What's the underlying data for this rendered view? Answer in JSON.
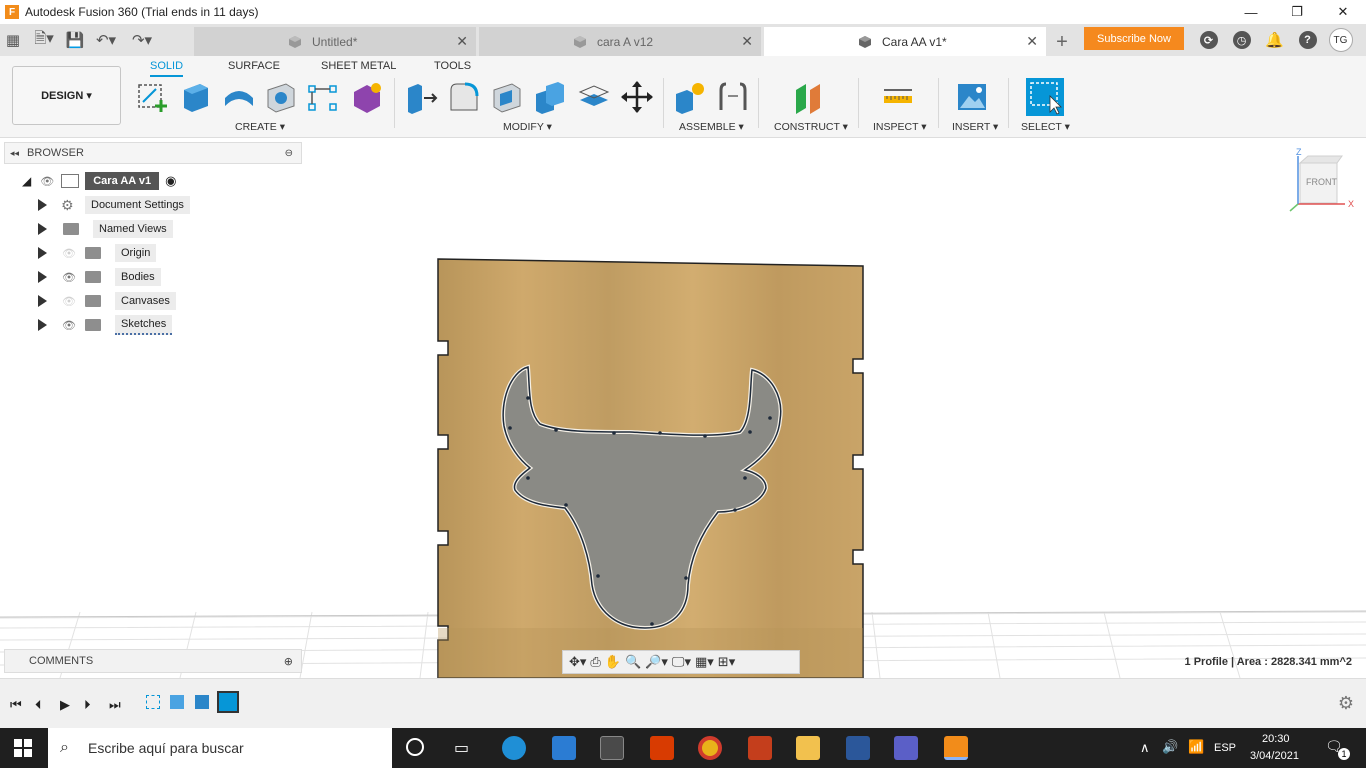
{
  "window": {
    "title": "Autodesk Fusion 360 (Trial ends in 11 days)",
    "logo": "F"
  },
  "tabs": [
    {
      "label": "Untitled*",
      "active": false
    },
    {
      "label": "cara A v12",
      "active": false
    },
    {
      "label": "Cara AA v1*",
      "active": true
    }
  ],
  "subscribe_label": "Subscribe Now",
  "user_initials": "TG",
  "ribbon": {
    "workspace": "DESIGN",
    "tabs": [
      "SOLID",
      "SURFACE",
      "SHEET METAL",
      "TOOLS"
    ],
    "groups": [
      "CREATE",
      "MODIFY",
      "ASSEMBLE",
      "CONSTRUCT",
      "INSPECT",
      "INSERT",
      "SELECT"
    ]
  },
  "browser": {
    "header": "BROWSER",
    "root": "Cara AA v1",
    "items": [
      "Document Settings",
      "Named Views",
      "Origin",
      "Bodies",
      "Canvases",
      "Sketches"
    ]
  },
  "viewcube_label": "FRONT",
  "axis_labels": {
    "z": "Z",
    "x": "X"
  },
  "comments_label": "COMMENTS",
  "status_text": "1 Profile | Area : 2828.341 mm^2",
  "taskbar": {
    "search_placeholder": "Escribe aquí para buscar",
    "lang": "ESP",
    "time": "20:30",
    "date": "3/04/2021",
    "notification_count": "1"
  },
  "colors": {
    "accent": "#0696d7",
    "subscribe": "#f5891e",
    "wood": "#c8a56a",
    "profile": "#8a8a85"
  }
}
